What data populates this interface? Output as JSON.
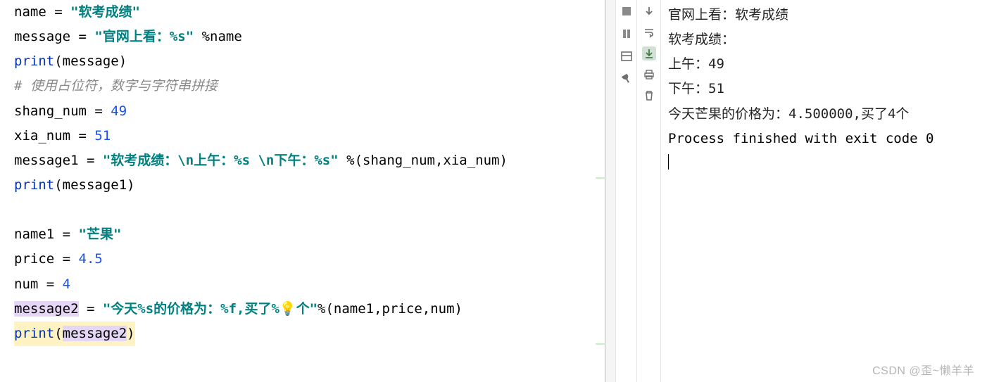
{
  "code": {
    "l1": {
      "a": "name ",
      "b": "= ",
      "c": "\"软考成绩\""
    },
    "l2": {
      "a": "message ",
      "b": "= ",
      "c": "\"官网上看：%s\"",
      "d": " %name"
    },
    "l3": {
      "a": "print",
      "b": "(message)"
    },
    "l4": "# 使用占位符，数字与字符串拼接",
    "l5": {
      "a": "shang_num ",
      "b": "= ",
      "c": "49"
    },
    "l6": {
      "a": "xia_num ",
      "b": "= ",
      "c": "51"
    },
    "l7": {
      "a": "message1 ",
      "b": "= ",
      "c": "\"软考成绩：\\n上午：%s \\n下午：%s\"",
      "d": " %(shang_num,xia_num)"
    },
    "l8": {
      "a": "print",
      "b": "(message1)"
    },
    "l9": "",
    "l10": {
      "a": "name1 ",
      "b": "= ",
      "c": "\"芒果\""
    },
    "l11": {
      "a": "price ",
      "b": "= ",
      "c": "4.5"
    },
    "l12": {
      "a": "num ",
      "b": "= ",
      "c": "4"
    },
    "l13": {
      "a": "message2",
      "b": " = ",
      "c1": "\"今天%s的价格为：%f,买了%",
      "c2": "个\"",
      "d": "%(name1,price,num)"
    },
    "l14": {
      "a": "print",
      "b": "(",
      "c": "message2",
      "d": ")"
    }
  },
  "console": {
    "o1": "官网上看：软考成绩",
    "o2": "软考成绩：",
    "o3": "上午：49",
    "o4": "下午：51",
    "o5": "今天芒果的价格为：4.500000,买了4个",
    "blank": "",
    "proc": "Process finished with exit code 0"
  },
  "watermark": "CSDN @歪~懒羊羊"
}
